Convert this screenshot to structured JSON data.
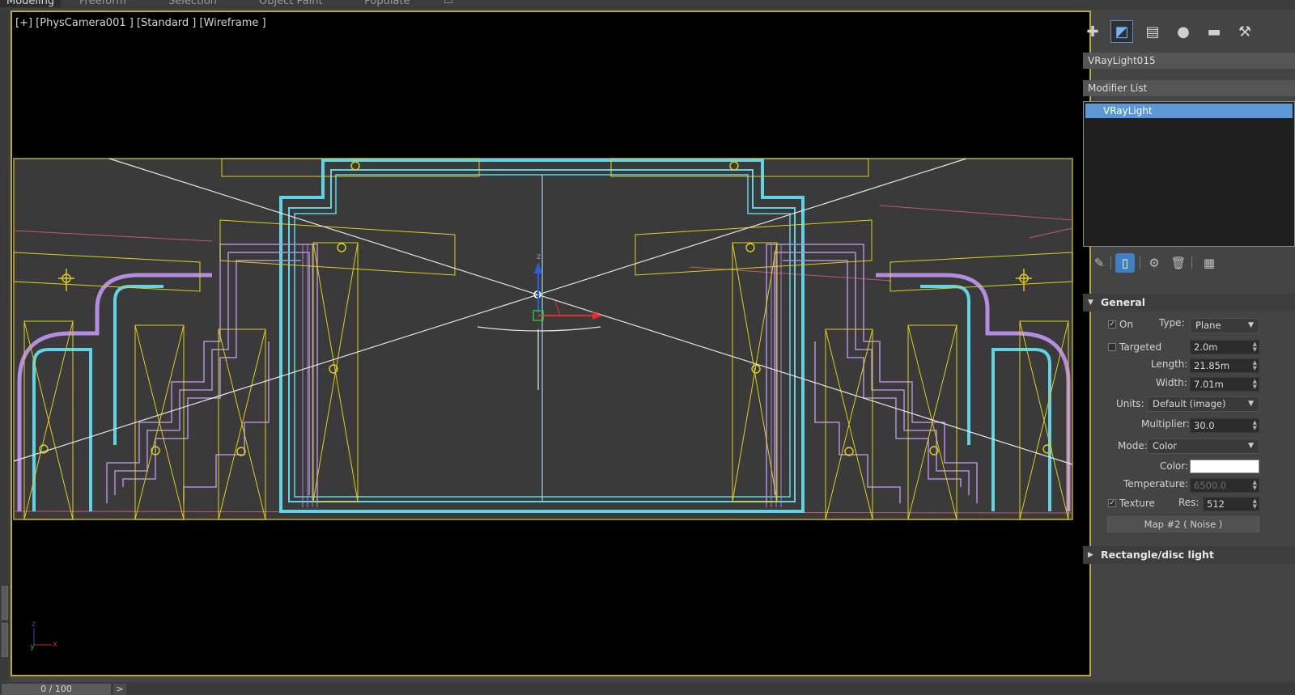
{
  "ribbon": {
    "tabs": [
      "Modeling",
      "Freeform",
      "Selection",
      "Object Paint",
      "Populate"
    ]
  },
  "viewport": {
    "label": "[+] [PhysCamera001 ] [Standard ] [Wireframe ]",
    "colors": {
      "background": "#000000",
      "safe_frame": "#b6a63c",
      "lights": "#e0d01c",
      "cyan_geometry": "#5fd3e8",
      "purple_geometry": "#b48ce0",
      "selection": "#d8d8d8"
    }
  },
  "command_panel": {
    "tabs": [
      "create-icon",
      "modify-icon",
      "hierarchy-icon",
      "motion-icon",
      "display-icon",
      "utilities-icon"
    ],
    "object_name": "VRayLight015",
    "modifier_list_label": "Modifier List",
    "stack_items": [
      "VRayLight"
    ],
    "general": {
      "header": "General",
      "on_label": "On",
      "on_checked": true,
      "type_label": "Type:",
      "type_value": "Plane",
      "targeted_label": "Targeted",
      "targeted_checked": false,
      "targeted_value": "2.0m",
      "length_label": "Length:",
      "length_value": "21.85m",
      "width_label": "Width:",
      "width_value": "7.01m",
      "units_label": "Units:",
      "units_value": "Default (image)",
      "multiplier_label": "Multiplier:",
      "multiplier_value": "30.0",
      "mode_label": "Mode:",
      "mode_value": "Color",
      "color_label": "Color:",
      "color_value": "#ffffff",
      "temperature_label": "Temperature:",
      "temperature_value": "6500.0",
      "texture_label": "Texture",
      "texture_checked": true,
      "res_label": "Res:",
      "res_value": "512",
      "map_button": "Map #2  ( Noise )"
    },
    "rect_disc_header": "Rectangle/disc light"
  },
  "timeline": {
    "slider_label": "0 / 100",
    "next_label": ">"
  }
}
